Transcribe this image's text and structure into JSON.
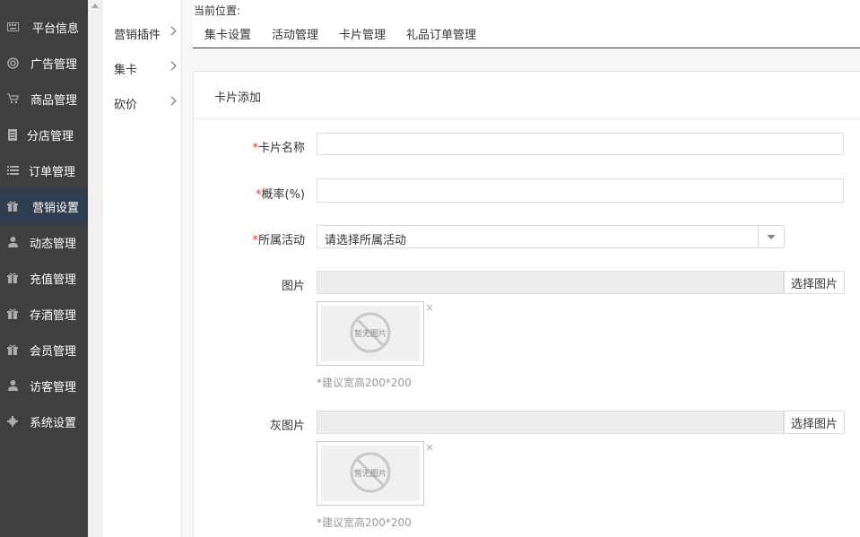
{
  "sidebar": {
    "items": [
      {
        "label": "平台信息",
        "icon": "keyboard-icon"
      },
      {
        "label": "广告管理",
        "icon": "lifebuoy-icon"
      },
      {
        "label": "商品管理",
        "icon": "cart-icon"
      },
      {
        "label": "分店管理",
        "icon": "document-icon"
      },
      {
        "label": "订单管理",
        "icon": "list-icon"
      },
      {
        "label": "营销设置",
        "icon": "gift-icon",
        "active": true
      },
      {
        "label": "动态管理",
        "icon": "user-icon"
      },
      {
        "label": "充值管理",
        "icon": "gift-icon"
      },
      {
        "label": "存酒管理",
        "icon": "gift-icon"
      },
      {
        "label": "会员管理",
        "icon": "gift-icon"
      },
      {
        "label": "访客管理",
        "icon": "user-icon"
      },
      {
        "label": "系统设置",
        "icon": "gear-icon"
      }
    ]
  },
  "submenu": {
    "items": [
      {
        "label": "营销插件"
      },
      {
        "label": "集卡"
      },
      {
        "label": "砍价"
      }
    ]
  },
  "breadcrumb": {
    "label": "当前位置:"
  },
  "tabs": [
    {
      "label": "集卡设置"
    },
    {
      "label": "活动管理"
    },
    {
      "label": "卡片管理"
    },
    {
      "label": "礼品订单管理"
    }
  ],
  "panel": {
    "title": "卡片添加"
  },
  "form": {
    "card_name": {
      "label": "卡片名称",
      "value": ""
    },
    "probability": {
      "label": "概率(%)",
      "value": ""
    },
    "activity": {
      "label": "所属活动",
      "selected": "请选择所属活动"
    },
    "image": {
      "label": "图片",
      "button": "选择图片",
      "placeholder": "暂无图片",
      "remove": "×",
      "hint": "*建议宽高200*200"
    },
    "gray_image": {
      "label": "灰图片",
      "button": "选择图片",
      "placeholder": "暂无图片",
      "remove": "×",
      "hint": "*建议宽高200*200"
    },
    "required_mark": "*"
  },
  "colors": {
    "sidebar_bg": "#3f3f3f",
    "sidebar_active": "#2f3d4f",
    "required": "#ee3333"
  }
}
